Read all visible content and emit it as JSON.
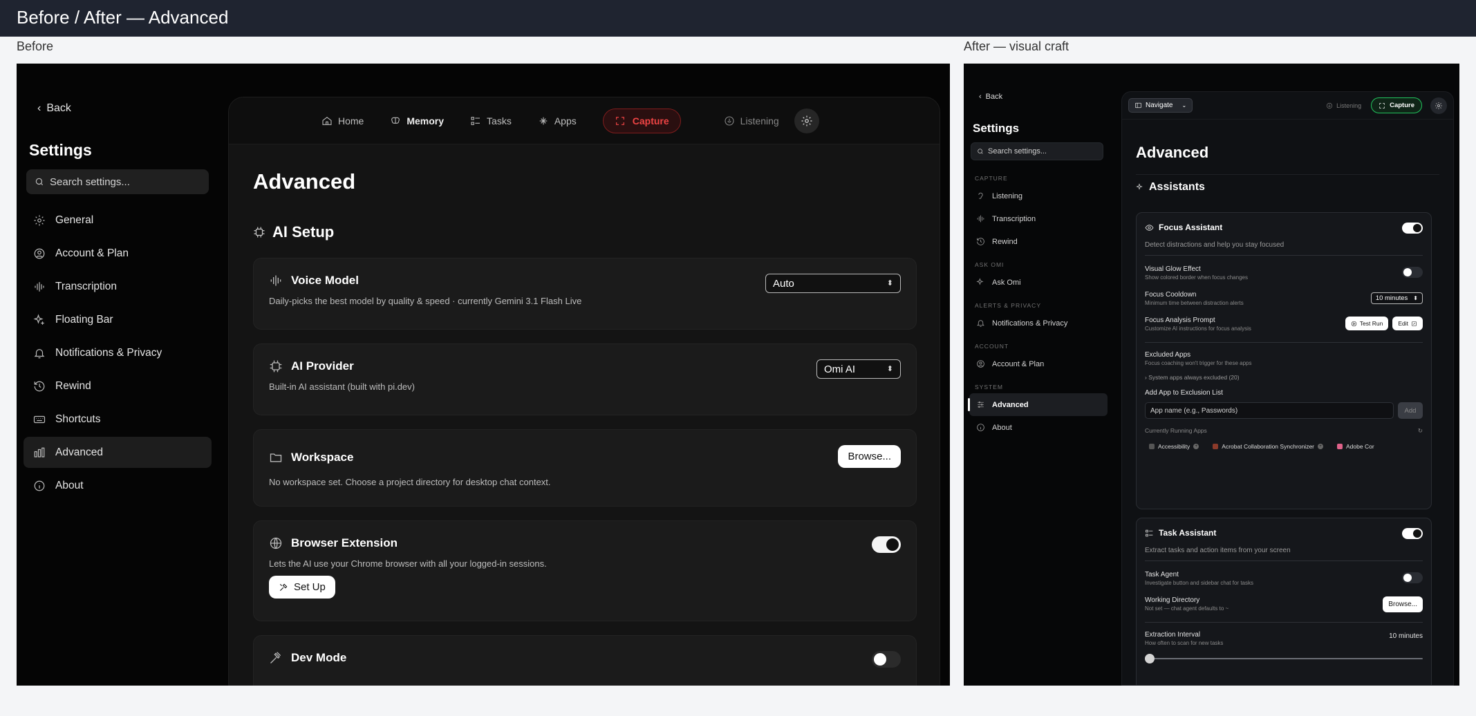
{
  "header": {
    "title": "Before / After — Advanced"
  },
  "labels": {
    "before": "Before",
    "after": "After — visual craft"
  },
  "before": {
    "back": "Back",
    "settings_title": "Settings",
    "search_placeholder": "Search settings...",
    "nav": [
      {
        "label": "General",
        "icon": "gear-icon"
      },
      {
        "label": "Account & Plan",
        "icon": "user-circle-icon"
      },
      {
        "label": "Transcription",
        "icon": "waveform-icon"
      },
      {
        "label": "Floating Bar",
        "icon": "sparkle-icon"
      },
      {
        "label": "Notifications & Privacy",
        "icon": "bell-icon"
      },
      {
        "label": "Rewind",
        "icon": "history-icon"
      },
      {
        "label": "Shortcuts",
        "icon": "keyboard-icon"
      },
      {
        "label": "Advanced",
        "icon": "bars-icon",
        "active": true
      },
      {
        "label": "About",
        "icon": "info-icon"
      }
    ],
    "topnav": {
      "home": "Home",
      "memory": "Memory",
      "tasks": "Tasks",
      "apps": "Apps",
      "capture": "Capture",
      "listening": "Listening"
    },
    "page_title": "Advanced",
    "section": "AI Setup",
    "cards": {
      "voice_model": {
        "title": "Voice Model",
        "desc": "Daily-picks the best model by quality & speed · currently Gemini 3.1 Flash Live",
        "value": "Auto"
      },
      "ai_provider": {
        "title": "AI Provider",
        "desc": "Built-in AI assistant (built with pi.dev)",
        "value": "Omi AI"
      },
      "workspace": {
        "title": "Workspace",
        "desc": "No workspace set. Choose a project directory for desktop chat context.",
        "button": "Browse..."
      },
      "browser_extension": {
        "title": "Browser Extension",
        "desc": "Lets the AI use your Chrome browser with all your logged-in sessions.",
        "button": "Set Up",
        "enabled": true
      },
      "dev_mode": {
        "title": "Dev Mode",
        "enabled": false
      }
    }
  },
  "after": {
    "back": "Back",
    "settings_title": "Settings",
    "search_placeholder": "Search settings...",
    "groups": {
      "capture": "CAPTURE",
      "ask_omi": "ASK OMI",
      "alerts": "ALERTS & PRIVACY",
      "account": "ACCOUNT",
      "system": "SYSTEM"
    },
    "nav": {
      "listening": "Listening",
      "transcription": "Transcription",
      "rewind": "Rewind",
      "ask_omi": "Ask Omi",
      "notifications": "Notifications & Privacy",
      "account_plan": "Account & Plan",
      "advanced": "Advanced",
      "about": "About"
    },
    "topbar": {
      "navigate": "Navigate",
      "listening": "Listening",
      "capture": "Capture"
    },
    "page_title": "Advanced",
    "section": "Assistants",
    "focus": {
      "title": "Focus Assistant",
      "desc": "Detect distractions and help you stay focused",
      "enabled": true,
      "glow_title": "Visual Glow Effect",
      "glow_sub": "Show colored border when focus changes",
      "glow_enabled": false,
      "cooldown_title": "Focus Cooldown",
      "cooldown_sub": "Minimum time between distraction alerts",
      "cooldown_value": "10 minutes",
      "prompt_title": "Focus Analysis Prompt",
      "prompt_sub": "Customize AI instructions for focus analysis",
      "test_run": "Test Run",
      "edit": "Edit",
      "excluded_title": "Excluded Apps",
      "excluded_sub": "Focus coaching won't trigger for these apps",
      "system_apps": "System apps always excluded (20)",
      "add_title": "Add App to Exclusion List",
      "add_placeholder": "App name (e.g., Passwords)",
      "add_button": "Add",
      "running_title": "Currently Running Apps",
      "running_apps": [
        "Accessibility",
        "Acrobat Collaboration Synchronizer",
        "Adobe Cor"
      ]
    },
    "task": {
      "title": "Task Assistant",
      "desc": "Extract tasks and action items from your screen",
      "enabled": true,
      "agent_title": "Task Agent",
      "agent_sub": "Investigate button and sidebar chat for tasks",
      "agent_enabled": false,
      "dir_title": "Working Directory",
      "dir_sub": "Not set — chat agent defaults to ~",
      "dir_button": "Browse...",
      "interval_title": "Extraction Interval",
      "interval_sub": "How often to scan for new tasks",
      "interval_value": "10 minutes"
    }
  }
}
